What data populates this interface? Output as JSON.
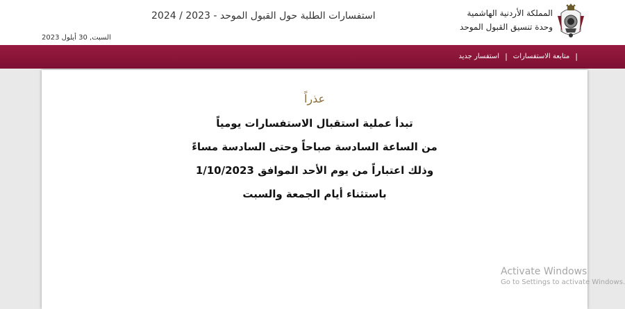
{
  "header": {
    "org_name": "المملكة الأردنية الهاشمية",
    "unit_name": "وحدة تنسيق القبول الموحد",
    "site_title": "استفسارات الطلبة حول القبول الموحد - 2023 / 2024",
    "date": "السبت, 30 أيلول 2023",
    "emblem_icon": "jordan-coat-of-arms-icon"
  },
  "nav": {
    "items": [
      {
        "label": "استفسار جديد"
      },
      {
        "label": "متابعة الاستفسارات"
      }
    ],
    "separator": "|",
    "color": "#8b1538"
  },
  "notice": {
    "title": "عذراً",
    "lines": [
      "تبدأ عملية استقبال الاستفسارات يومياً",
      "من الساعة السادسة صباحاً وحتى السادسة مساءً",
      "وذلك اعتباراً من يوم الأحد الموافق 1/10/2023",
      "باستثناء أيام الجمعة والسبت"
    ]
  },
  "watermark": {
    "line1": "Activate Windows",
    "line2": "Go to Settings to activate Windows."
  }
}
